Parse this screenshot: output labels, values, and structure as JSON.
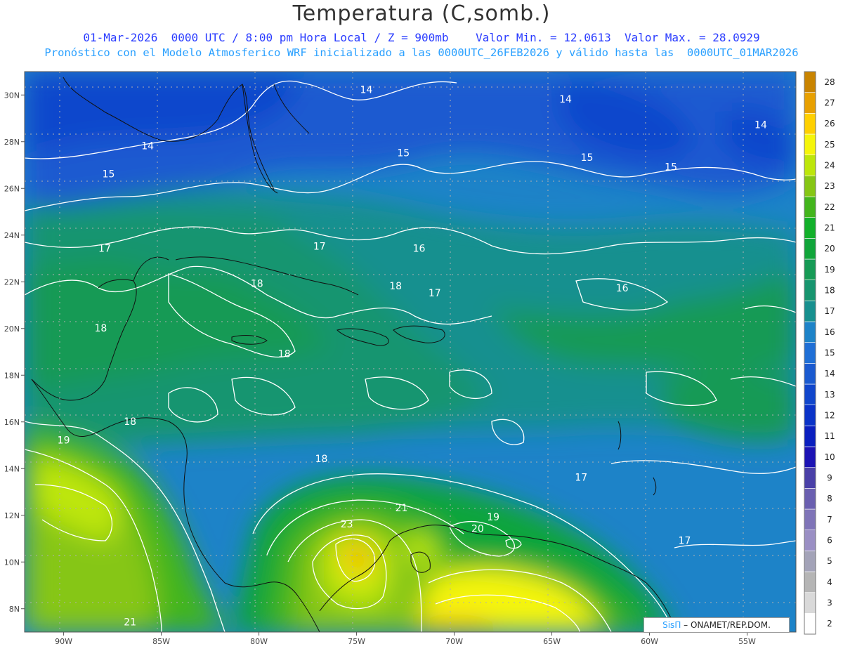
{
  "title": "Temperatura (C,somb.)",
  "subtitle_line1": "01-Mar-2026  0000 UTC / 8:00 pm Hora Local / Z = 900mb    Valor Min. = 12.0613  Valor Max. = 28.0929",
  "subtitle_line2": "Pronóstico con el Modelo Atmosferico WRF inicializado a las 0000UTC_26FEB2026 y válido hasta las  0000UTC_01MAR2026",
  "credit": {
    "brand": "SisΠ",
    "text": "– ONAMET/REP.DOM."
  },
  "axes": {
    "x_ticks": [
      "90W",
      "85W",
      "80W",
      "75W",
      "70W",
      "65W",
      "60W",
      "55W"
    ],
    "y_ticks": [
      "30N",
      "28N",
      "26N",
      "24N",
      "22N",
      "20N",
      "18N",
      "16N",
      "14N",
      "12N",
      "10N",
      "8N"
    ],
    "x_range": [
      -92,
      -52.5
    ],
    "y_range": [
      7,
      31
    ]
  },
  "colorbar": {
    "levels": [
      2,
      3,
      4,
      5,
      6,
      7,
      8,
      9,
      10,
      11,
      12,
      13,
      14,
      15,
      16,
      17,
      18,
      19,
      20,
      21,
      22,
      23,
      24,
      25,
      26,
      27,
      28
    ],
    "colors": [
      "#ffffff",
      "#d9d9d9",
      "#b5b5b5",
      "#a3a3b8",
      "#9a8fc4",
      "#7f74b8",
      "#6a5fb0",
      "#4a40a8",
      "#1c13b4",
      "#0a1fbf",
      "#0a33c8",
      "#1046cc",
      "#1a5ad0",
      "#1f6fd6",
      "#1d83c8",
      "#17908f",
      "#17956f",
      "#169a55",
      "#10a53a",
      "#12b02a",
      "#43b51c",
      "#86c614",
      "#bde60a",
      "#f5f50a",
      "#ffd000",
      "#e8a000",
      "#c98400"
    ]
  },
  "contour_labels": [
    {
      "text": "14",
      "lon": -74.5,
      "lat": 30.2
    },
    {
      "text": "14",
      "lon": -64.3,
      "lat": 29.8
    },
    {
      "text": "14",
      "lon": -54.3,
      "lat": 28.7
    },
    {
      "text": "14",
      "lon": -85.7,
      "lat": 27.8
    },
    {
      "text": "15",
      "lon": -72.6,
      "lat": 27.5
    },
    {
      "text": "15",
      "lon": -63.2,
      "lat": 27.3
    },
    {
      "text": "15",
      "lon": -58.9,
      "lat": 26.9
    },
    {
      "text": "15",
      "lon": -87.7,
      "lat": 26.6
    },
    {
      "text": "17",
      "lon": -87.9,
      "lat": 23.4
    },
    {
      "text": "17",
      "lon": -76.9,
      "lat": 23.5
    },
    {
      "text": "16",
      "lon": -71.8,
      "lat": 23.4
    },
    {
      "text": "18",
      "lon": -80.1,
      "lat": 21.9
    },
    {
      "text": "18",
      "lon": -73.0,
      "lat": 21.8
    },
    {
      "text": "17",
      "lon": -71.0,
      "lat": 21.5
    },
    {
      "text": "16",
      "lon": -61.4,
      "lat": 21.7
    },
    {
      "text": "18",
      "lon": -88.1,
      "lat": 20.0
    },
    {
      "text": "18",
      "lon": -78.7,
      "lat": 18.9
    },
    {
      "text": "18",
      "lon": -86.6,
      "lat": 16.0
    },
    {
      "text": "19",
      "lon": -90.0,
      "lat": 15.2
    },
    {
      "text": "18",
      "lon": -76.8,
      "lat": 14.4
    },
    {
      "text": "17",
      "lon": -63.5,
      "lat": 13.6
    },
    {
      "text": "21",
      "lon": -72.7,
      "lat": 12.3
    },
    {
      "text": "19",
      "lon": -68.0,
      "lat": 11.9
    },
    {
      "text": "23",
      "lon": -75.5,
      "lat": 11.6
    },
    {
      "text": "20",
      "lon": -68.8,
      "lat": 11.4
    },
    {
      "text": "17",
      "lon": -58.2,
      "lat": 10.9
    },
    {
      "text": "21",
      "lon": -86.6,
      "lat": 7.4
    }
  ]
}
